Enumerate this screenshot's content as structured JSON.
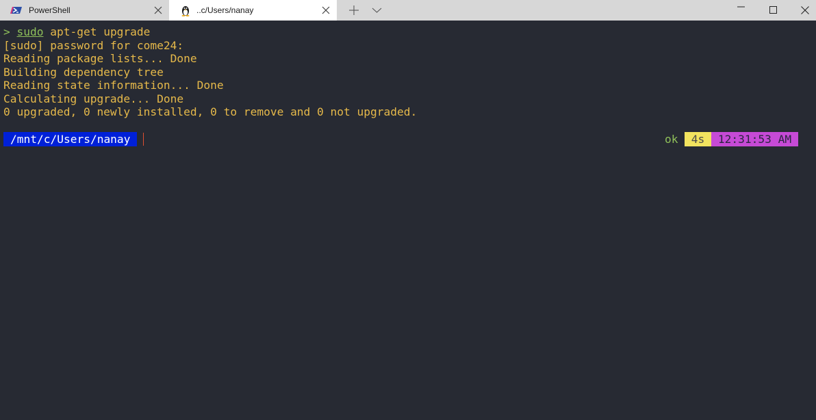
{
  "tabs": [
    {
      "title": "PowerShell",
      "icon": "powershell-icon",
      "active": false
    },
    {
      "title": "..c/Users/nanay",
      "icon": "linux-penguin-icon",
      "active": true
    }
  ],
  "terminal": {
    "prompt_symbol": ">",
    "command": {
      "sudo": "sudo",
      "rest": " apt-get upgrade"
    },
    "output": [
      "[sudo] password for come24:",
      "Reading package lists... Done",
      "Building dependency tree",
      "Reading state information... Done",
      "Calculating upgrade... Done",
      "0 upgraded, 0 newly installed, 0 to remove and 0 not upgraded."
    ],
    "prompt_path": "/mnt/c/Users/nanay",
    "status": "ok",
    "duration": "4s",
    "time": "12:31:53 AM"
  },
  "colors": {
    "background": "#272a33",
    "output_text": "#e6b94a",
    "prompt_green": "#8fc05a",
    "path_bg": "#0020d8",
    "duration_bg": "#f2e35f",
    "time_bg": "#c64ad6"
  }
}
